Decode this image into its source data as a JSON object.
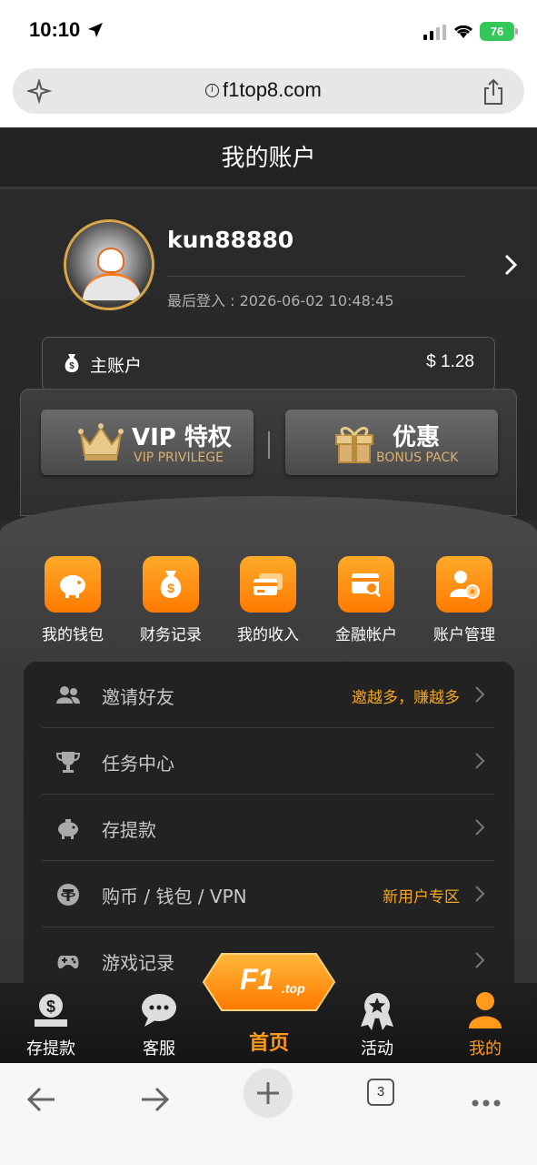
{
  "status_bar": {
    "time": "10:10",
    "battery": "76"
  },
  "browser": {
    "url": "f1top8.com",
    "tabs_count": "3"
  },
  "header": {
    "title": "我的账户"
  },
  "profile": {
    "username": "kun88880",
    "last_login": "最后登入 : 2026-06-02 10:48:45"
  },
  "account": {
    "label": "主账户",
    "balance": "$ 1.28"
  },
  "promos": {
    "vip": {
      "title": "VIP 特权",
      "subtitle": "VIP PRIVILEGE"
    },
    "bonus": {
      "title": "优惠",
      "subtitle": "BONUS PACK"
    }
  },
  "quick_actions": [
    {
      "label": "我的钱包",
      "icon": "piggy-bank-icon"
    },
    {
      "label": "财务记录",
      "icon": "money-bag-icon"
    },
    {
      "label": "我的收入",
      "icon": "cards-icon"
    },
    {
      "label": "金融帐户",
      "icon": "card-search-icon"
    },
    {
      "label": "账户管理",
      "icon": "user-settings-icon"
    }
  ],
  "menu": [
    {
      "label": "邀请好友",
      "right": "邀越多，赚越多",
      "icon": "users-icon"
    },
    {
      "label": "任务中心",
      "right": "",
      "icon": "trophy-icon"
    },
    {
      "label": "存提款",
      "right": "",
      "icon": "piggy-icon"
    },
    {
      "label": "购币 / 钱包 / VPN",
      "right": "新用户专区",
      "icon": "tether-icon"
    },
    {
      "label": "游戏记录",
      "right": "",
      "icon": "gamepad-icon"
    }
  ],
  "tabbar": {
    "deposit": "存提款",
    "service": "客服",
    "home": "首页",
    "events": "活动",
    "mine": "我的",
    "logo_main": "F1",
    "logo_sub": ".top"
  },
  "colors": {
    "accent": "#ff9a1a",
    "highlight": "#f5a623",
    "battery": "#34c759"
  }
}
